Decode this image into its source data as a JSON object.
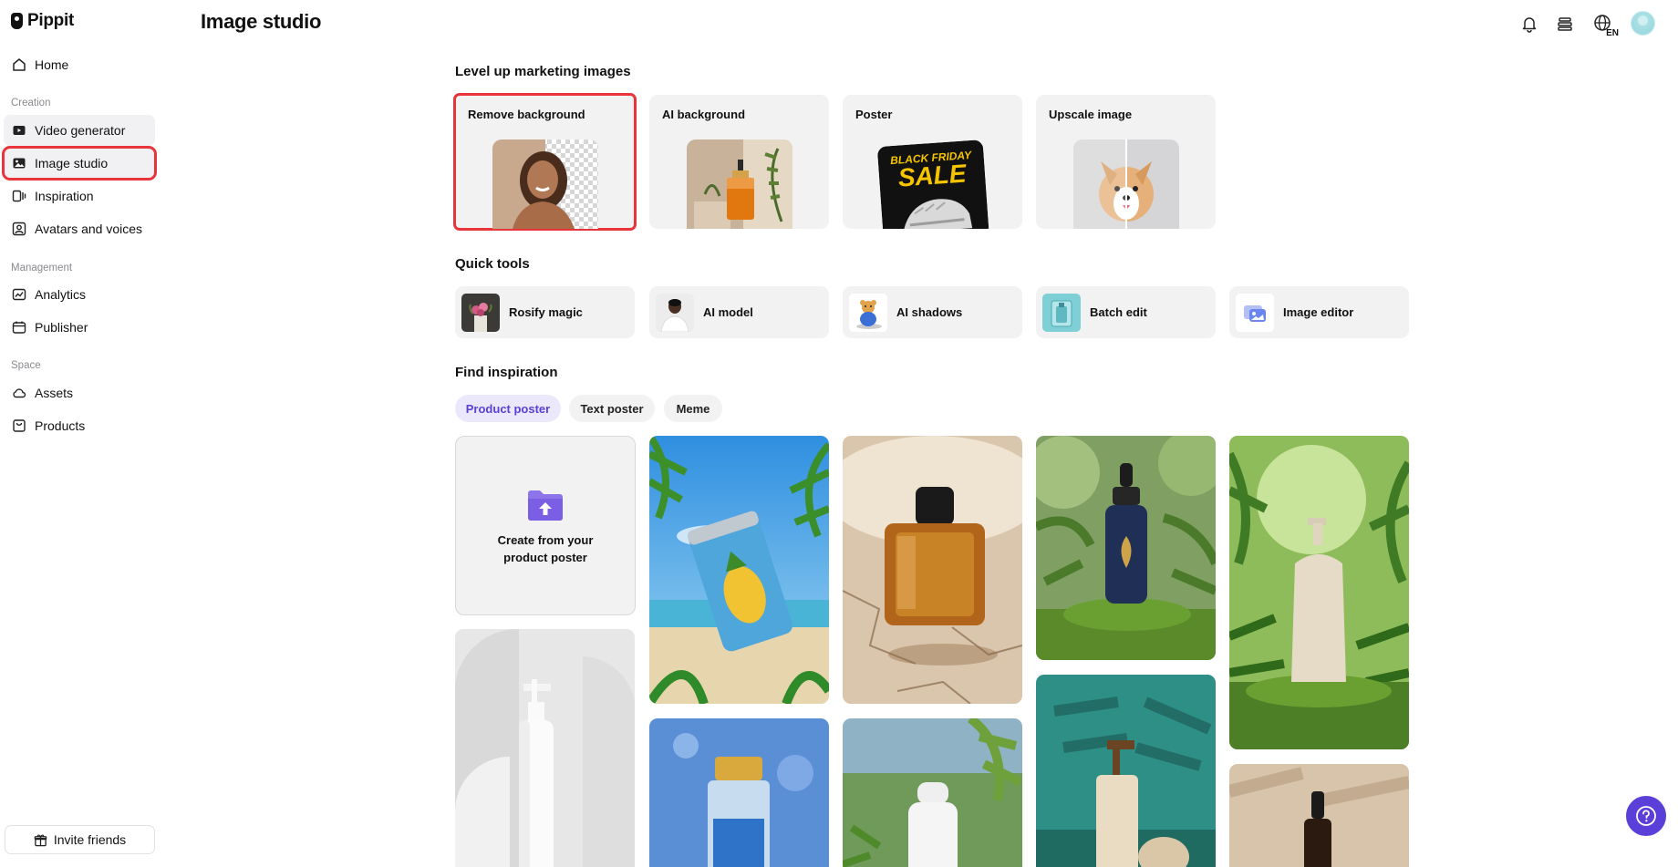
{
  "app": {
    "name": "Pippit",
    "page_title": "Image studio"
  },
  "sidebar": {
    "items": [
      {
        "label": "Home"
      },
      {
        "label": "Video generator"
      },
      {
        "label": "Image studio"
      },
      {
        "label": "Inspiration"
      },
      {
        "label": "Avatars and voices"
      },
      {
        "label": "Analytics"
      },
      {
        "label": "Publisher"
      },
      {
        "label": "Assets"
      },
      {
        "label": "Products"
      }
    ],
    "sections": {
      "creation": "Creation",
      "management": "Management",
      "space": "Space"
    },
    "invite_label": "Invite friends"
  },
  "header": {
    "language": "EN"
  },
  "marketing": {
    "title": "Level up marketing images",
    "cards": [
      {
        "label": "Remove background"
      },
      {
        "label": "AI background"
      },
      {
        "label": "Poster",
        "poster_line1": "BLACK FRIDAY",
        "poster_line2": "SALE"
      },
      {
        "label": "Upscale image"
      }
    ]
  },
  "quick_tools": {
    "title": "Quick tools",
    "items": [
      {
        "label": "Rosify magic"
      },
      {
        "label": "AI model"
      },
      {
        "label": "AI shadows"
      },
      {
        "label": "Batch edit"
      },
      {
        "label": "Image editor"
      }
    ]
  },
  "inspiration": {
    "title": "Find inspiration",
    "tabs": [
      {
        "label": "Product poster",
        "active": true
      },
      {
        "label": "Text poster",
        "active": false
      },
      {
        "label": "Meme",
        "active": false
      }
    ],
    "create_label": "Create from your product poster"
  },
  "colors": {
    "accent": "#5b3fd9",
    "highlight": "#e8353c",
    "active_pill_bg": "#ece8fb",
    "card_bg": "#f2f2f3"
  }
}
